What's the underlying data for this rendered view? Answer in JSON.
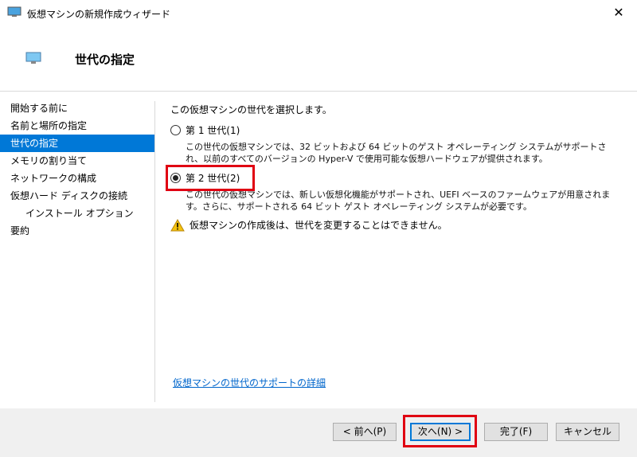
{
  "window": {
    "title": "仮想マシンの新規作成ウィザード",
    "close_glyph": "✕"
  },
  "header": {
    "title": "世代の指定"
  },
  "nav": {
    "items": [
      {
        "label": "開始する前に"
      },
      {
        "label": "名前と場所の指定"
      },
      {
        "label": "世代の指定",
        "active": true
      },
      {
        "label": "メモリの割り当て"
      },
      {
        "label": "ネットワークの構成"
      },
      {
        "label": "仮想ハード ディスクの接続"
      },
      {
        "label": "インストール オプション",
        "sub": true
      },
      {
        "label": "要約"
      }
    ]
  },
  "main": {
    "instruction": "この仮想マシンの世代を選択します。",
    "gen1": {
      "label": "第 1 世代(1)",
      "selected": false,
      "description": "この世代の仮想マシンでは、32 ビットおよび 64 ビットのゲスト オペレーティング システムがサポートされ、以前のすべてのバージョンの Hyper-V で使用可能な仮想ハードウェアが提供されます。"
    },
    "gen2": {
      "label": "第 2 世代(2)",
      "selected": true,
      "description": "この世代の仮想マシンでは、新しい仮想化機能がサポートされ、UEFI ベースのファームウェアが用意されます。さらに、サポートされる 64 ビット ゲスト オペレーティング システムが必要です。"
    },
    "warning": "仮想マシンの作成後は、世代を変更することはできません。",
    "link": "仮想マシンの世代のサポートの詳細"
  },
  "buttons": {
    "prev": "< 前へ(P)",
    "next": "次へ(N) >",
    "finish": "完了(F)",
    "cancel": "キャンセル"
  },
  "colors": {
    "accent": "#0078d7",
    "highlight": "#e00012",
    "link": "#0066cc"
  }
}
